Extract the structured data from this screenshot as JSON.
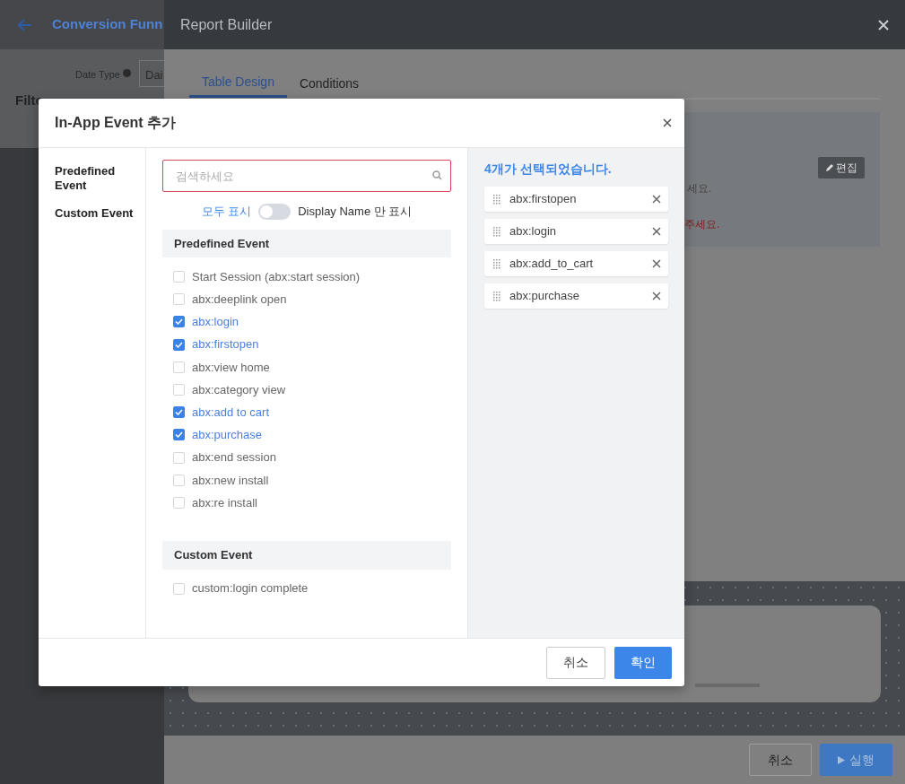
{
  "app": {
    "title": "Conversion Funn",
    "date_type_label": "Date Type",
    "date_type_value": "Dai",
    "filter_label": "Filte"
  },
  "report_builder": {
    "title": "Report Builder",
    "tabs": [
      {
        "label": "Table Design",
        "selected": true
      },
      {
        "label": "Conditions",
        "selected": false
      }
    ],
    "edit_button": "편집",
    "hint_fragments": [
      {
        "text": "세요.",
        "kind": "normal"
      },
      {
        "text": "주세요.",
        "kind": "warning"
      }
    ],
    "footer_buttons": [
      {
        "label": "취소",
        "kind": "secondary"
      },
      {
        "label": "실행",
        "kind": "primary"
      }
    ]
  },
  "modal": {
    "title": "In-App Event 추가",
    "nav": [
      "Predefined Event",
      "Custom Event"
    ],
    "search": {
      "placeholder": "검색하세요"
    },
    "toggle": {
      "left_label": "모두 표시",
      "right_label": "Display Name 만 표시",
      "on": false
    },
    "groups": [
      {
        "title": "Predefined Event",
        "items": [
          {
            "label": "Start Session (abx:start session)",
            "checked": false
          },
          {
            "label": "abx:deeplink open",
            "checked": false
          },
          {
            "label": "abx:login",
            "checked": true
          },
          {
            "label": "abx:firstopen",
            "checked": true
          },
          {
            "label": "abx:view home",
            "checked": false
          },
          {
            "label": "abx:category view",
            "checked": false
          },
          {
            "label": "abx:add to cart",
            "checked": true
          },
          {
            "label": "abx:purchase",
            "checked": true
          },
          {
            "label": "abx:end session",
            "checked": false
          },
          {
            "label": "abx:new install",
            "checked": false
          },
          {
            "label": "abx:re install",
            "checked": false
          }
        ]
      },
      {
        "title": "Custom Event",
        "items": [
          {
            "label": "custom:login complete",
            "checked": false
          }
        ]
      }
    ],
    "selected_title": "4개가 선택되었습니다.",
    "selected": [
      "abx:firstopen",
      "abx:login",
      "abx:add_to_cart",
      "abx:purchase"
    ],
    "buttons": [
      {
        "label": "취소",
        "kind": "secondary"
      },
      {
        "label": "확인",
        "kind": "primary"
      }
    ]
  }
}
